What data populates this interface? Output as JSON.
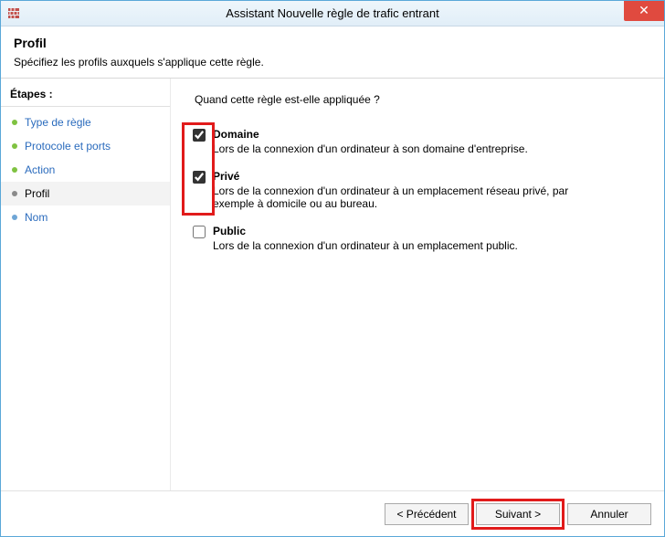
{
  "window": {
    "title": "Assistant Nouvelle règle de trafic entrant",
    "close_tooltip": "Fermer"
  },
  "header": {
    "page_title": "Profil",
    "subtitle": "Spécifiez les profils auxquels s'applique cette règle."
  },
  "sidebar": {
    "header": "Étapes :",
    "items": [
      {
        "label": "Type de règle",
        "state": "done"
      },
      {
        "label": "Protocole et ports",
        "state": "done"
      },
      {
        "label": "Action",
        "state": "done"
      },
      {
        "label": "Profil",
        "state": "current"
      },
      {
        "label": "Nom",
        "state": "future"
      }
    ]
  },
  "content": {
    "question": "Quand cette règle est-elle appliquée ?",
    "profiles": [
      {
        "key": "domain",
        "title": "Domaine",
        "description": "Lors de la connexion d'un ordinateur à son domaine d'entreprise.",
        "checked": true
      },
      {
        "key": "private",
        "title": "Privé",
        "description": "Lors de la connexion d'un ordinateur à un emplacement réseau privé, par exemple à domicile ou au bureau.",
        "checked": true
      },
      {
        "key": "public",
        "title": "Public",
        "description": "Lors de la connexion d'un ordinateur à un emplacement public.",
        "checked": false
      }
    ]
  },
  "footer": {
    "back": "< Précédent",
    "next": "Suivant >",
    "cancel": "Annuler"
  },
  "highlights": {
    "checkbox_group": true,
    "next_button": true
  }
}
